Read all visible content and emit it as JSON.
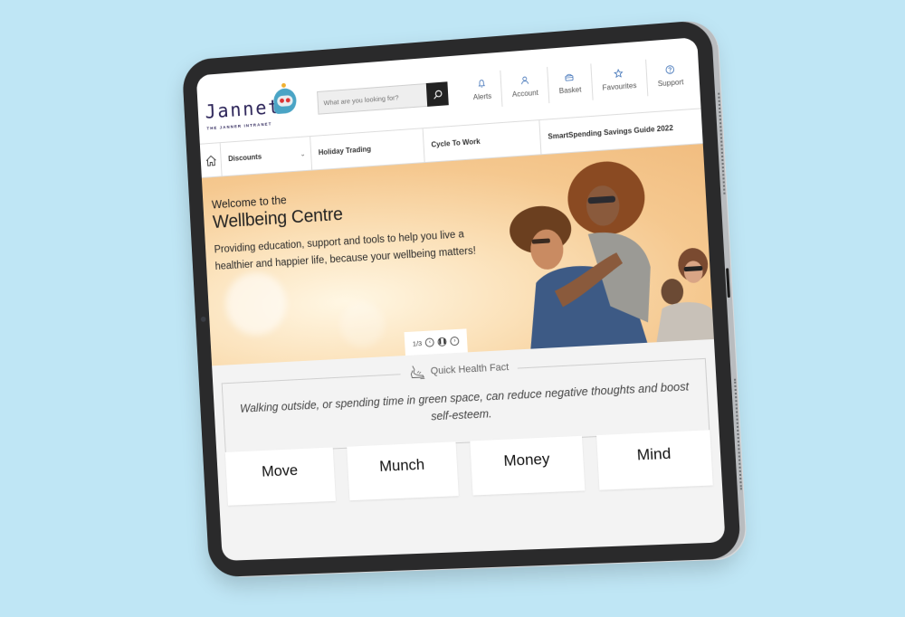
{
  "brand": {
    "name": "Jannet",
    "tagline": "THE JANNER INTRANET"
  },
  "search": {
    "placeholder": "What are you looking for?",
    "value": ""
  },
  "utilities": [
    {
      "label": "Alerts",
      "icon": "bell-icon"
    },
    {
      "label": "Account",
      "icon": "user-icon"
    },
    {
      "label": "Basket",
      "icon": "basket-icon"
    },
    {
      "label": "Favourites",
      "icon": "star-icon"
    },
    {
      "label": "Support",
      "icon": "help-icon"
    }
  ],
  "nav": {
    "home_icon": "home-icon",
    "items": [
      {
        "label": "Discounts",
        "has_dropdown": true
      },
      {
        "label": "Holiday Trading"
      },
      {
        "label": "Cycle To Work"
      },
      {
        "label": "SmartSpending Savings Guide 2022"
      }
    ]
  },
  "hero": {
    "pretitle": "Welcome to the",
    "title": "Wellbeing Centre",
    "body": "Providing education, support and tools to help you live a healthier and happier life, because your wellbeing matters!",
    "carousel": {
      "counter": "1/3",
      "current": 1,
      "total": 3
    }
  },
  "health_fact": {
    "heading": "Quick Health Fact",
    "icon": "running-shoe-icon",
    "text": "Walking outside, or spending time in green space, can reduce negative thoughts and boost self-esteem."
  },
  "cards": [
    {
      "label": "Move"
    },
    {
      "label": "Munch"
    },
    {
      "label": "Money"
    },
    {
      "label": "Mind"
    }
  ],
  "colors": {
    "background": "#bfe6f5",
    "bezel": "#2a2a2b",
    "brand_navy": "#2b2358",
    "brand_teal": "#4aa4c5",
    "icon_blue": "#3b6fb6",
    "search_button": "#222222"
  }
}
